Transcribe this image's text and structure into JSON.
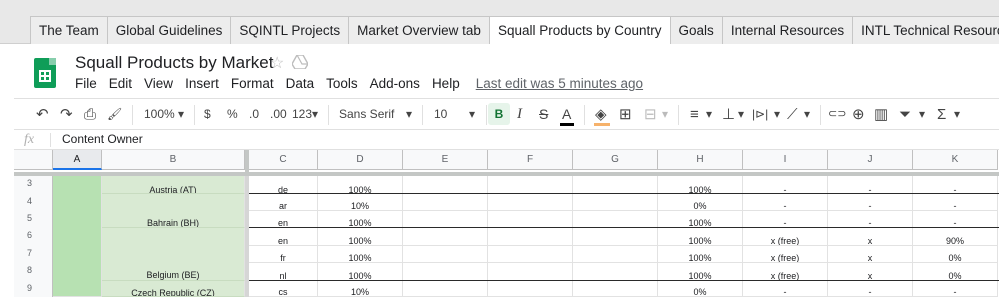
{
  "tabs": [
    {
      "label": "The Team",
      "active": false
    },
    {
      "label": "Global Guidelines",
      "active": false
    },
    {
      "label": "SQINTL Projects",
      "active": false
    },
    {
      "label": "Market Overview tab",
      "active": false
    },
    {
      "label": "Squall Products by Country",
      "active": true
    },
    {
      "label": "Goals",
      "active": false
    },
    {
      "label": "Internal Resources",
      "active": false
    },
    {
      "label": "INTL Technical Resources",
      "active": false
    }
  ],
  "header": {
    "title": "Squall Products by Market",
    "menu": [
      "File",
      "Edit",
      "View",
      "Insert",
      "Format",
      "Data",
      "Tools",
      "Add-ons",
      "Help"
    ],
    "last_edit": "Last edit was 5 minutes ago",
    "logo_color": "#0f9d58"
  },
  "toolbar": {
    "undo": "↶",
    "redo": "↷",
    "print": "⎙",
    "paint_format": "🖌",
    "zoom": "100%",
    "currency": "$",
    "percent": "%",
    "decimal_decrease": ".0",
    "decimal_increase": ".00",
    "more_formats": "123",
    "font": "Sans Serif",
    "font_size": "10",
    "bold": "B",
    "italic": "I",
    "strike": "S",
    "text_color": "A",
    "fill_icon": "◈",
    "borders_icon": "⊞",
    "merge_icon": "⊟",
    "align_icon": "≡",
    "valign_icon": "⊥",
    "wrap_icon": "|⊳|",
    "rotate_icon": "⟋",
    "link_icon": "⊂⊃",
    "comment_icon": "⊕",
    "chart_icon": "▥",
    "filter_icon": "⏷",
    "functions_icon": "Σ",
    "caret": "▾"
  },
  "formula_bar": {
    "fx": "fx",
    "value": "Content Owner"
  },
  "columns": [
    "A",
    "B",
    "C",
    "D",
    "E",
    "F",
    "G",
    "H",
    "I",
    "J",
    "K"
  ],
  "rows": [
    {
      "num": "3",
      "country": "Austria (AT)",
      "c": "de",
      "d": "100%",
      "h": "100%",
      "i": "-",
      "j": "-",
      "k": "-"
    },
    {
      "num": "4",
      "country": "",
      "c": "ar",
      "d": "10%",
      "h": "0%",
      "i": "-",
      "j": "-",
      "k": "-"
    },
    {
      "num": "5",
      "country": "Bahrain (BH)",
      "c": "en",
      "d": "100%",
      "h": "100%",
      "i": "-",
      "j": "-",
      "k": "-"
    },
    {
      "num": "6",
      "country": "",
      "c": "en",
      "d": "100%",
      "h": "100%",
      "i": "x (free)",
      "j": "x",
      "k": "90%"
    },
    {
      "num": "7",
      "country": "",
      "c": "fr",
      "d": "100%",
      "h": "100%",
      "i": "x (free)",
      "j": "x",
      "k": "0%"
    },
    {
      "num": "8",
      "country": "Belgium (BE)",
      "c": "nl",
      "d": "100%",
      "h": "100%",
      "i": "x (free)",
      "j": "x",
      "k": "0%"
    },
    {
      "num": "9",
      "country": "Czech Republic (CZ)",
      "c": "cs",
      "d": "10%",
      "h": "0%",
      "i": "-",
      "j": "-",
      "k": "-"
    }
  ]
}
